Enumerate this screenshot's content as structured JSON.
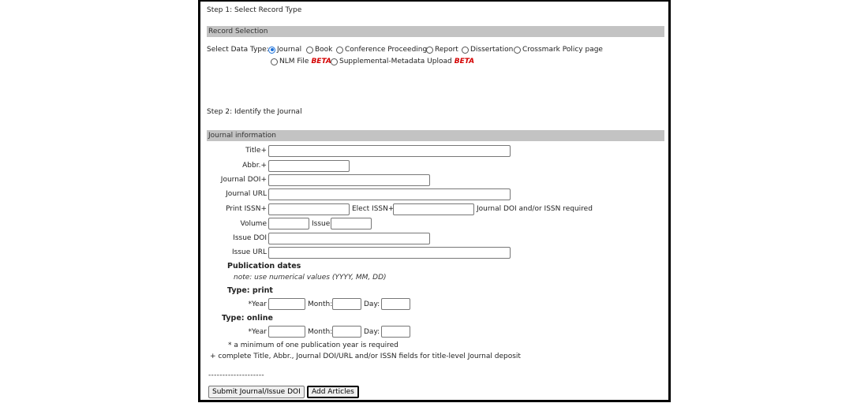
{
  "step1": {
    "title": "Step 1: Select Record Type",
    "section_title": "Record Selection",
    "data_type_label": "Select Data Type:",
    "options": [
      {
        "label": "Journal",
        "selected": true,
        "beta": ""
      },
      {
        "label": "Book",
        "selected": false,
        "beta": ""
      },
      {
        "label": "Conference Proceedings",
        "selected": false,
        "beta": ""
      },
      {
        "label": "Report",
        "selected": false,
        "beta": ""
      },
      {
        "label": "Dissertation",
        "selected": false,
        "beta": ""
      },
      {
        "label": "Crossmark Policy page",
        "selected": false,
        "beta": ""
      },
      {
        "label": "NLM File",
        "selected": false,
        "beta": "BETA"
      },
      {
        "label": "Supplemental-Metadata Upload",
        "selected": false,
        "beta": "BETA"
      }
    ]
  },
  "step2": {
    "title": "Step 2: Identify the Journal",
    "section_title": "Journal information",
    "fields": {
      "title": {
        "label": "Title+",
        "value": ""
      },
      "abbr": {
        "label": "Abbr.+",
        "value": ""
      },
      "journal_doi": {
        "label": "Journal DOI+",
        "value": ""
      },
      "journal_url": {
        "label": "Journal URL",
        "value": ""
      },
      "print_issn": {
        "label": "Print ISSN+",
        "value": ""
      },
      "elect_issn": {
        "label": "Elect ISSN+",
        "value": ""
      },
      "issn_note": "Journal DOI and/or ISSN required",
      "volume": {
        "label": "Volume",
        "value": ""
      },
      "issue": {
        "label": "Issue",
        "value": ""
      },
      "issue_doi": {
        "label": "Issue DOI",
        "value": ""
      },
      "issue_url": {
        "label": "Issue URL",
        "value": ""
      }
    },
    "pub_dates": {
      "heading": "Publication dates",
      "note": "note: use numerical values (YYYY, MM, DD)",
      "print_label": "Type: print",
      "online_label": "Type: online",
      "year_label": "*Year",
      "month_label": "Month:",
      "day_label": "Day:"
    },
    "footnote_year": "* a minimum of one publication year is required",
    "footnote_plus": "+ complete Title, Abbr., Journal DOI/URL and/or ISSN fields for title-level Journal deposit",
    "divider": "--------------------"
  },
  "buttons": {
    "submit": "Submit Journal/Issue DOI",
    "add_articles": "Add Articles"
  }
}
